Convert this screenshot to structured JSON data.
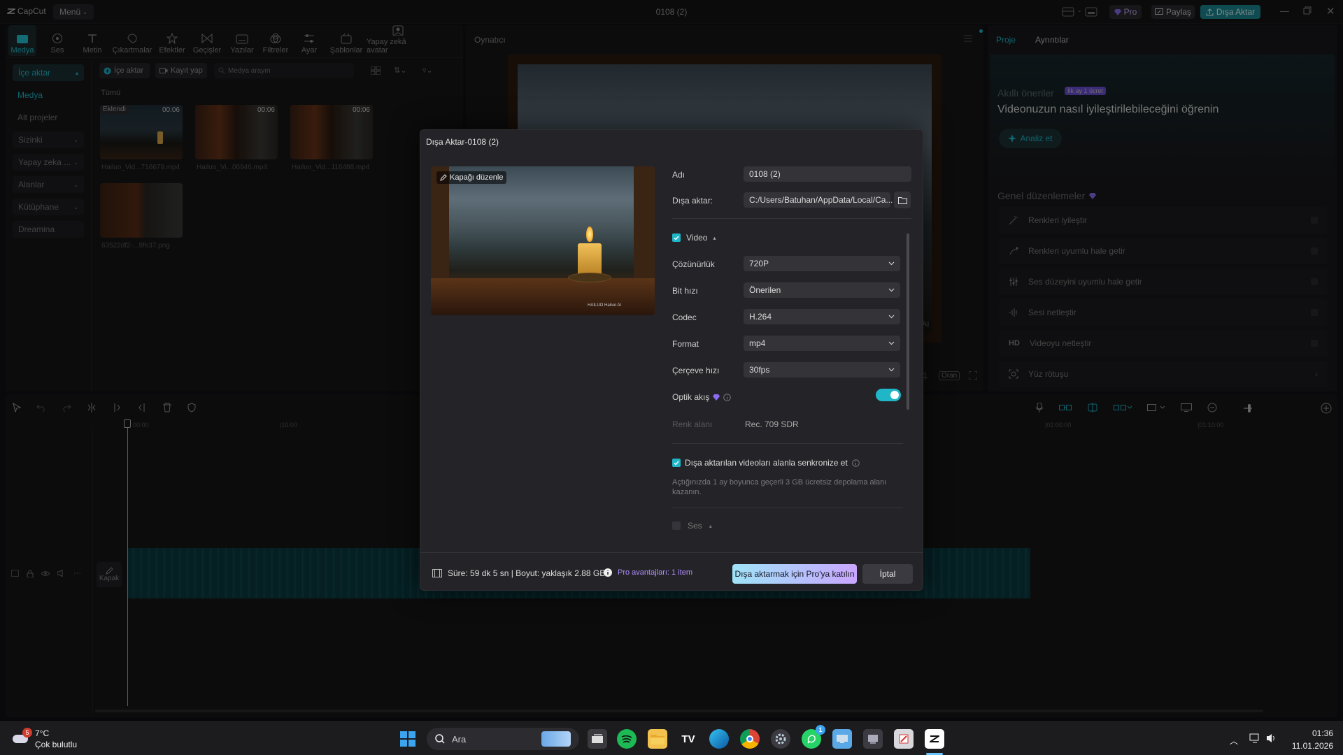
{
  "app": {
    "logo": "CapCut",
    "menu": "Menü",
    "window_title": "0108 (2)",
    "pro_label": "Pro",
    "share_label": "Paylaş",
    "export_label": "Dışa Aktar"
  },
  "toolbar": [
    "Medya",
    "Ses",
    "Metin",
    "Çıkartmalar",
    "Efektler",
    "Geçişler",
    "Yazılar",
    "Filtreler",
    "Ayar",
    "Şablonlar",
    "Yapay zekâ avatar"
  ],
  "sidebar": {
    "import": "İçe aktar",
    "items": [
      "Medya",
      "Alt projeler",
      "Sizinki",
      "Yapay zeka ...",
      "Alanlar",
      "Kütüphane",
      "Dreamina"
    ]
  },
  "media": {
    "import_btn": "İçe aktar",
    "record_btn": "Kayıt yap",
    "search_placeholder": "Medya arayın",
    "filter_all": "Tümü",
    "added_badge": "Eklendi",
    "clips": [
      {
        "name": "Hailuo_Vid...716679.mp4",
        "dur": "00:06"
      },
      {
        "name": "Hailuo_Vi...06946.mp4",
        "dur": "00:06"
      },
      {
        "name": "Hailuo_Vid...116488.mp4",
        "dur": "00:06"
      },
      {
        "name": "63522df2-...9fe37.png",
        "dur": ""
      }
    ]
  },
  "player": {
    "title": "Oynatıcı",
    "ratio": "Oran",
    "ai_mark": "AI"
  },
  "right": {
    "tab_project": "Proje",
    "tab_details": "Ayrıntılar",
    "smart_title": "Akıllı öneriler",
    "smart_badge": "İlk ay 1 ücret",
    "smart_heading": "Videonuzun nasıl iyileştirilebileceğini öğrenin",
    "analyze": "Analiz et",
    "general_title": "Genel düzenlemeler",
    "edits": [
      {
        "icon": "wand-icon",
        "label": "Renkleri iyileştir"
      },
      {
        "icon": "color-match-icon",
        "label": "Renkleri uyumlu hale getir"
      },
      {
        "icon": "equalizer-icon",
        "label": "Ses düzeyini uyumlu hale getir"
      },
      {
        "icon": "voice-icon",
        "label": "Sesi netleştir"
      },
      {
        "icon": "hd-icon",
        "label": "Videoyu netleştir"
      },
      {
        "icon": "face-icon",
        "label": "Yüz rötuşu"
      }
    ]
  },
  "timeline": {
    "t0": "00:00",
    "t1": "|10:00",
    "t2": "|01:00:00",
    "t3": "|01:10:00",
    "cover": "Kapak"
  },
  "dialog": {
    "title": "Dışa Aktar-0108 (2)",
    "edit_cover": "Kapağı düzenle",
    "watermark": "HAILUO  Hailuo AI",
    "name_label": "Adı",
    "name_value": "0108 (2)",
    "path_label": "Dışa aktar:",
    "path_value": "C:/Users/Batuhan/AppData/Local/Ca...",
    "video_section": "Video",
    "settings": [
      {
        "label": "Çözünürlük",
        "value": "720P"
      },
      {
        "label": "Bit hızı",
        "value": "Önerilen"
      },
      {
        "label": "Codec",
        "value": "H.264"
      },
      {
        "label": "Format",
        "value": "mp4"
      },
      {
        "label": "Çerçeve hızı",
        "value": "30fps"
      }
    ],
    "optic_label": "Optik akış",
    "optic_on": true,
    "color_label": "Renk alanı",
    "color_value": "Rec. 709 SDR",
    "sync_label": "Dışa aktarılan videoları alanla senkronize et",
    "sync_note": "Açtığınızda 1 ay boyunca geçerli 3 GB ücretsiz depolama alanı kazanın.",
    "audio_section": "Ses",
    "footer_info": "Süre: 59 dk 5 sn | Boyut: yaklaşık 2.88 GB",
    "pro_benefits": "Pro avantajları: 1 item",
    "pro_join": "Dışa aktarmak için Pro'ya katılın",
    "cancel": "İptal"
  },
  "taskbar": {
    "temp": "7°C",
    "weather": "Çok bulutlu",
    "weather_badge": "5",
    "search": "Ara",
    "time": "01:36",
    "date": "11.01.2026",
    "whatsapp_badge": "1"
  },
  "colors": {
    "accent": "#1fb6c8",
    "pro_purple": "#8b6cf0",
    "pro_gradient_start": "#9fe3f7",
    "pro_gradient_end": "#c9a6ff"
  }
}
